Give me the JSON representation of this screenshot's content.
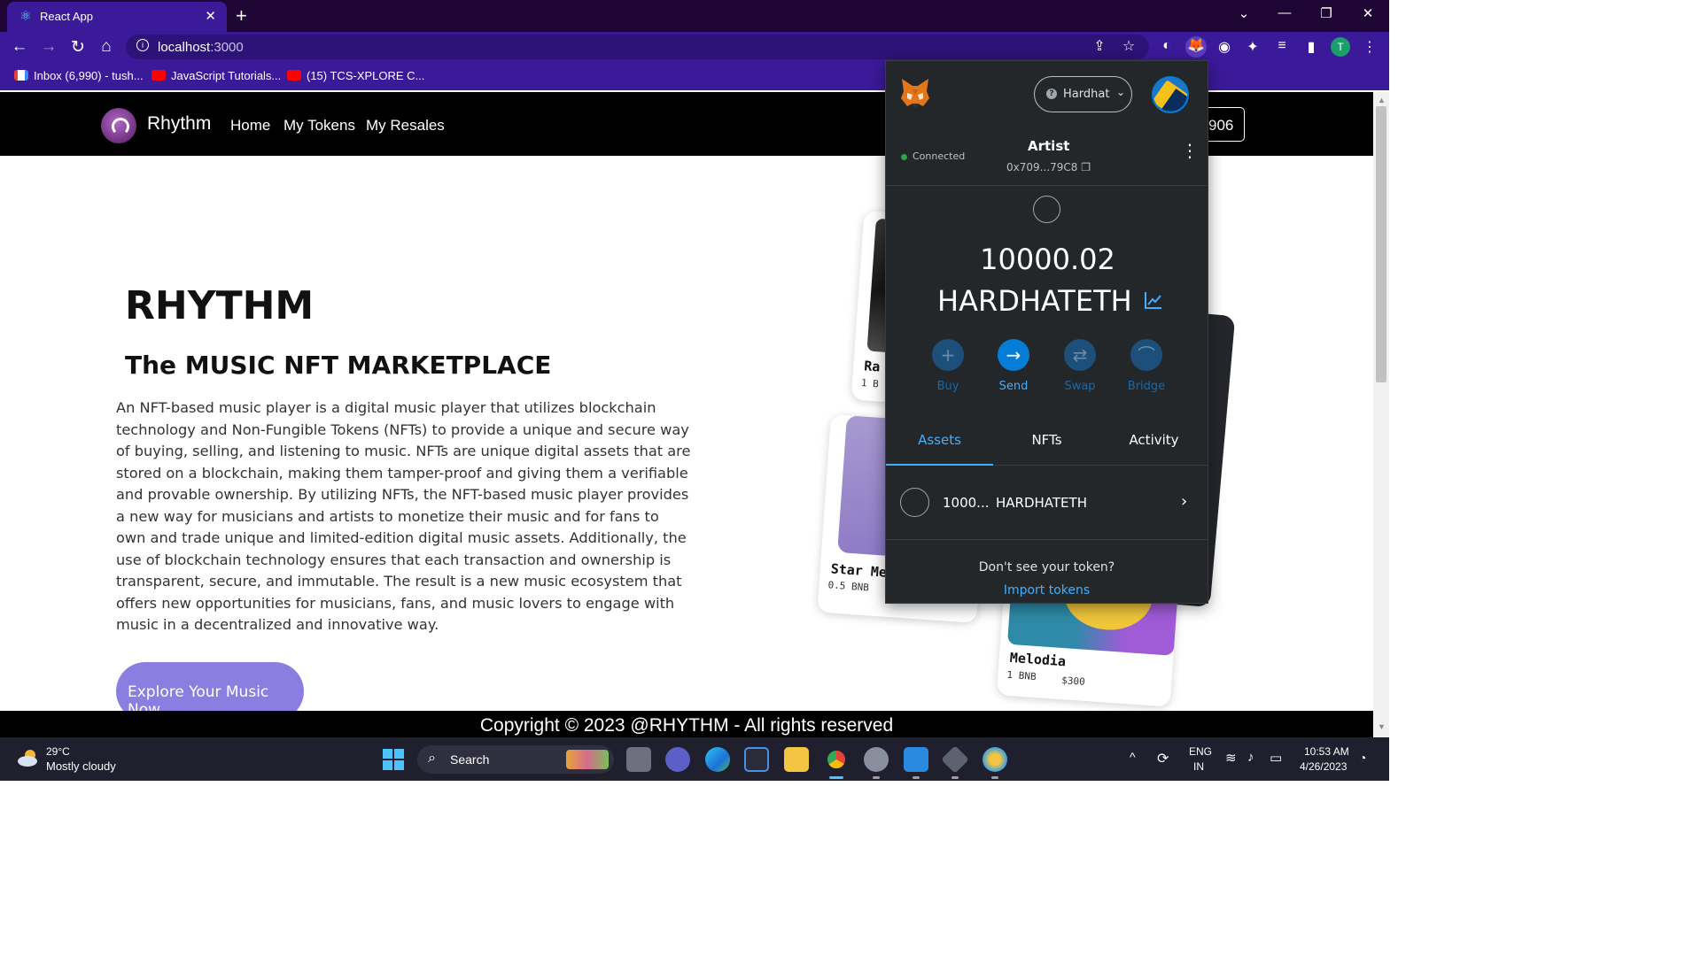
{
  "browser": {
    "tab_title": "React App",
    "url_host": "localhost",
    "url_port": ":3000",
    "bookmarks": [
      {
        "label": "Inbox (6,990) - tush...",
        "icon": "gmail-icon"
      },
      {
        "label": "JavaScript Tutorials...",
        "icon": "youtube-icon"
      },
      {
        "label": "(15) TCS-XPLORE C...",
        "icon": "youtube-icon"
      }
    ],
    "profile_initial": "T"
  },
  "site": {
    "brand": "Rhythm",
    "nav": [
      "Home",
      "My Tokens",
      "My Resales"
    ],
    "wallet_button": "906",
    "hero_title": "RHYTHM",
    "hero_subtitle": "The MUSIC NFT MARKETPLACE",
    "hero_text": "An NFT-based music player is a digital music player that utilizes blockchain technology and Non-Fungible Tokens (NFTs) to provide a unique and secure way of buying, selling, and listening to music. NFTs are unique digital assets that are stored on a blockchain, making them tamper-proof and giving them a verifiable and provable ownership. By utilizing NFTs, the NFT-based music player provides a new way for musicians and artists to monetize their music and for fans to own and trade unique and limited-edition digital music assets. Additionally, the use of blockchain technology ensures that each transaction and ownership is transparent, secure, and immutable. The result is a new music ecosystem that offers new opportunities for musicians, fans, and music lovers to engage with music in a decentralized and innovative way.",
    "cta": "Explore Your Music Now",
    "cards": [
      {
        "name": "Ra",
        "price": "1 B"
      },
      {
        "name": "Star Me",
        "price": "0.5 BNB"
      },
      {
        "name": "Melodia",
        "price": "1 BNB",
        "usd": "$300"
      }
    ],
    "footer": "Copyright © 2023 @RHYTHM - All rights reserved"
  },
  "metamask": {
    "network": "Hardhat",
    "status": "Connected",
    "account_name": "Artist",
    "account_address": "0x709...79C8",
    "balance": "10000.02",
    "ticker": "HARDHATETH",
    "actions": [
      "Buy",
      "Send",
      "Swap",
      "Bridge"
    ],
    "tabs": [
      "Assets",
      "NFTs",
      "Activity"
    ],
    "asset_amount": "1000...",
    "asset_symbol": "HARDHATETH",
    "dont_see": "Don't see your token?",
    "import": "Import tokens",
    "accent": "#037dd6"
  },
  "taskbar": {
    "temperature": "29°C",
    "weather": "Mostly cloudy",
    "search": "Search",
    "lang_1": "ENG",
    "lang_2": "IN",
    "time": "10:53 AM",
    "date": "4/26/2023"
  }
}
